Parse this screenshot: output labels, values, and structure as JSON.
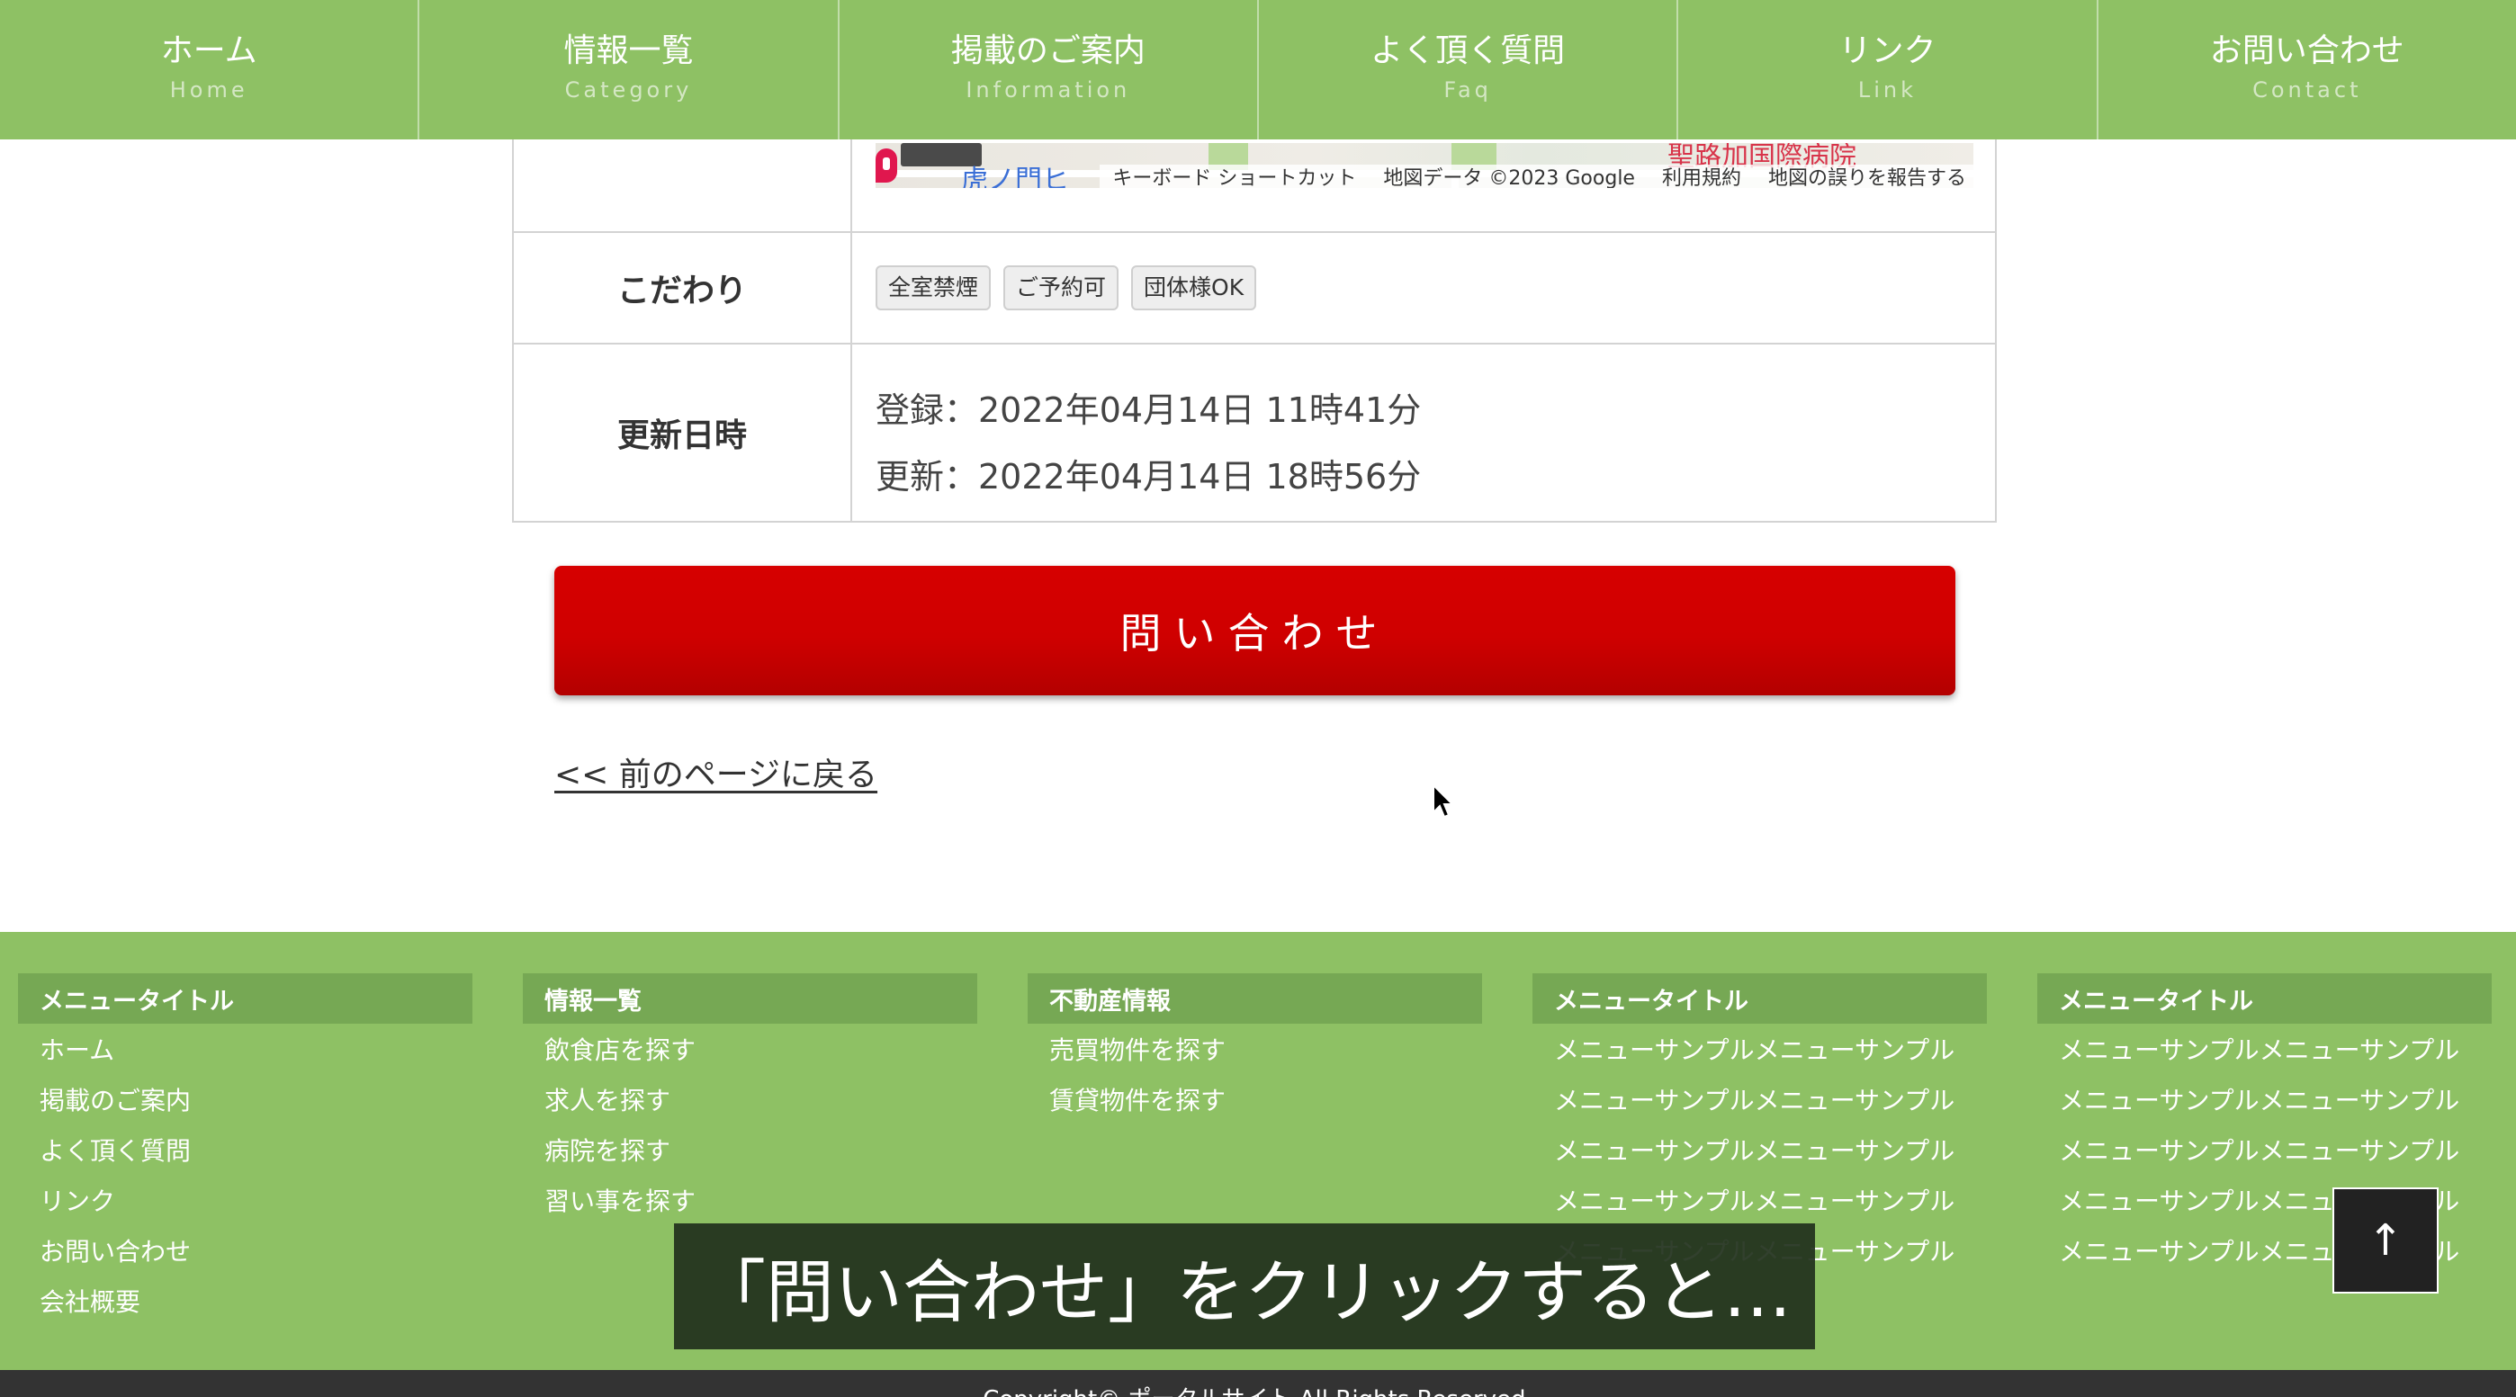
{
  "nav": [
    {
      "label": "ホーム",
      "sub": "Home"
    },
    {
      "label": "情報一覧",
      "sub": "Category"
    },
    {
      "label": "掲載のご案内",
      "sub": "Information"
    },
    {
      "label": "よく頂く質問",
      "sub": "Faq"
    },
    {
      "label": "リンク",
      "sub": "Link"
    },
    {
      "label": "お問い合わせ",
      "sub": "Contact"
    }
  ],
  "map": {
    "station": "虎ノ門ヒ",
    "hospital": "聖路加国際病院",
    "shortcuts": "キーボード ショートカット",
    "map_data": "地図データ ©2023 Google",
    "terms": "利用規約",
    "report": "地図の誤りを報告する"
  },
  "features": {
    "label": "こだわり",
    "tags": [
      "全室禁煙",
      "ご予約可",
      "団体様OK"
    ]
  },
  "updated": {
    "label": "更新日時",
    "registered": "登録：2022年04月14日 11時41分",
    "modified": "更新：2022年04月14日 18時56分"
  },
  "contact_button": "問い合わせ",
  "back_link": "<< 前のページに戻る",
  "footer": {
    "columns": [
      {
        "title": "メニュータイトル",
        "items": [
          "ホーム",
          "掲載のご案内",
          "よく頂く質問",
          "リンク",
          "お問い合わせ",
          "会社概要"
        ]
      },
      {
        "title": "情報一覧",
        "items": [
          "飲食店を探す",
          "求人を探す",
          "病院を探す",
          "習い事を探す"
        ]
      },
      {
        "title": "不動産情報",
        "items": [
          "売買物件を探す",
          "賃貸物件を探す"
        ]
      },
      {
        "title": "メニュータイトル",
        "items": [
          "メニューサンプルメニューサンプル",
          "メニューサンプルメニューサンプル",
          "メニューサンプルメニューサンプル",
          "メニューサンプルメニューサンプル",
          "メニューサンプルメニューサンプル"
        ]
      },
      {
        "title": "メニュータイトル",
        "items": [
          "メニューサンプルメニューサンプル",
          "メニューサンプルメニューサンプル",
          "メニューサンプルメニューサンプル",
          "メニューサンプルメニューサンプル",
          "メニューサンプルメニューサンプル"
        ]
      }
    ],
    "copyright": "Copyright© ポータルサイト All Rights Reserved."
  },
  "subtitle": "「問い合わせ」をクリックすると…",
  "to_top": "↑",
  "colors": {
    "green": "#8ec164",
    "green_dark": "#76a854",
    "button_red": "#cf0000"
  }
}
